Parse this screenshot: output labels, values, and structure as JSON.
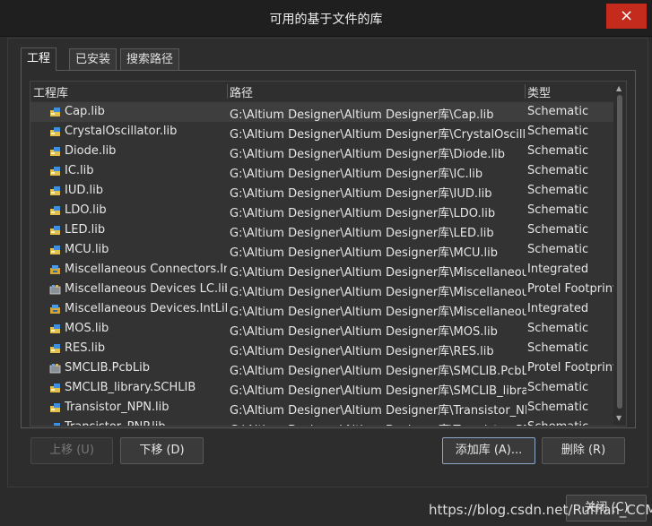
{
  "window": {
    "title": "可用的基于文件的库",
    "close_icon": "×"
  },
  "tabs": [
    {
      "label": "工程",
      "active": true
    },
    {
      "label": "已安装",
      "active": false
    },
    {
      "label": "搜索路径",
      "active": false
    }
  ],
  "table": {
    "columns": [
      "工程库",
      "路径",
      "类型"
    ],
    "rows": [
      {
        "name": "Cap.lib",
        "path": "G:\\Altium Designer\\Altium Designer库\\Cap.lib",
        "type": "Schematic",
        "icon": "schlib-icon",
        "selected": true
      },
      {
        "name": "CrystalOscillator.lib",
        "path": "G:\\Altium Designer\\Altium Designer库\\CrystalOscillator.lib",
        "type": "Schematic",
        "icon": "schlib-icon"
      },
      {
        "name": "Diode.lib",
        "path": "G:\\Altium Designer\\Altium Designer库\\Diode.lib",
        "type": "Schematic",
        "icon": "schlib-icon"
      },
      {
        "name": "IC.lib",
        "path": "G:\\Altium Designer\\Altium Designer库\\IC.lib",
        "type": "Schematic",
        "icon": "schlib-icon"
      },
      {
        "name": "IUD.lib",
        "path": "G:\\Altium Designer\\Altium Designer库\\IUD.lib",
        "type": "Schematic",
        "icon": "schlib-icon"
      },
      {
        "name": "LDO.lib",
        "path": "G:\\Altium Designer\\Altium Designer库\\LDO.lib",
        "type": "Schematic",
        "icon": "schlib-icon"
      },
      {
        "name": "LED.lib",
        "path": "G:\\Altium Designer\\Altium Designer库\\LED.lib",
        "type": "Schematic",
        "icon": "schlib-icon"
      },
      {
        "name": "MCU.lib",
        "path": "G:\\Altium Designer\\Altium Designer库\\MCU.lib",
        "type": "Schematic",
        "icon": "schlib-icon"
      },
      {
        "name": "Miscellaneous Connectors.IntLib",
        "path": "G:\\Altium Designer\\Altium Designer库\\Miscellaneous Connectors.IntLib",
        "type": "Integrated",
        "icon": "intlib-icon"
      },
      {
        "name": "Miscellaneous Devices LC.lib",
        "path": "G:\\Altium Designer\\Altium Designer库\\Miscellaneous Devices LC.lib",
        "type": "Protel Footprint",
        "icon": "pcblib-icon"
      },
      {
        "name": "Miscellaneous Devices.IntLib",
        "path": "G:\\Altium Designer\\Altium Designer库\\Miscellaneous Devices.IntLib",
        "type": "Integrated",
        "icon": "intlib-icon"
      },
      {
        "name": "MOS.lib",
        "path": "G:\\Altium Designer\\Altium Designer库\\MOS.lib",
        "type": "Schematic",
        "icon": "schlib-icon"
      },
      {
        "name": "RES.lib",
        "path": "G:\\Altium Designer\\Altium Designer库\\RES.lib",
        "type": "Schematic",
        "icon": "schlib-icon"
      },
      {
        "name": "SMCLIB.PcbLib",
        "path": "G:\\Altium Designer\\Altium Designer库\\SMCLIB.PcbLib",
        "type": "Protel Footprint",
        "icon": "pcblib-icon"
      },
      {
        "name": "SMCLIB_library.SCHLIB",
        "path": "G:\\Altium Designer\\Altium Designer库\\SMCLIB_library.SCHLIB",
        "type": "Schematic",
        "icon": "schlib-icon"
      },
      {
        "name": "Transistor_NPN.lib",
        "path": "G:\\Altium Designer\\Altium Designer库\\Transistor_NPN.lib",
        "type": "Schematic",
        "icon": "schlib-icon"
      },
      {
        "name": "Transistor_PNP.lib",
        "path": "G:\\Altium Designer\\Altium Designer库\\Transistor_PNP.lib",
        "type": "Schematic",
        "icon": "schlib-icon"
      }
    ]
  },
  "buttons": {
    "move_up": "上移 (U)",
    "move_down": "下移 (D)",
    "add_library": "添加库 (A)...",
    "remove": "删除 (R)",
    "close": "关闭 (C)"
  },
  "watermark": "https://blog.csdn.net/Ruffian_CCM",
  "colors": {
    "background": "#2b2b2b",
    "titlebar": "#1f1f1f",
    "close_button": "#c42b1c",
    "selected_row": "#3e3e3e"
  }
}
